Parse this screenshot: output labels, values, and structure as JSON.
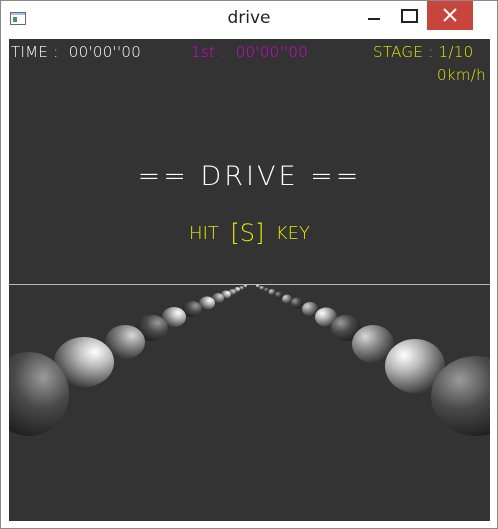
{
  "window": {
    "title": "drive"
  },
  "hud": {
    "time_label": "TIME",
    "time_value": "00'00''00",
    "best_label": "1st",
    "best_value": "00'00''00",
    "stage_label": "STAGE",
    "stage_value": "1/10",
    "speed": "0km/h"
  },
  "screen": {
    "title": "== DRIVE ==",
    "prompt_before": "HIT",
    "prompt_key": "[S]",
    "prompt_after": "KEY"
  },
  "colors": {
    "background": "#333333",
    "hud_time": "#ffffff",
    "hud_best": "#e000e0",
    "hud_stage": "#e8e800",
    "horizon": "#b8b8b8"
  }
}
